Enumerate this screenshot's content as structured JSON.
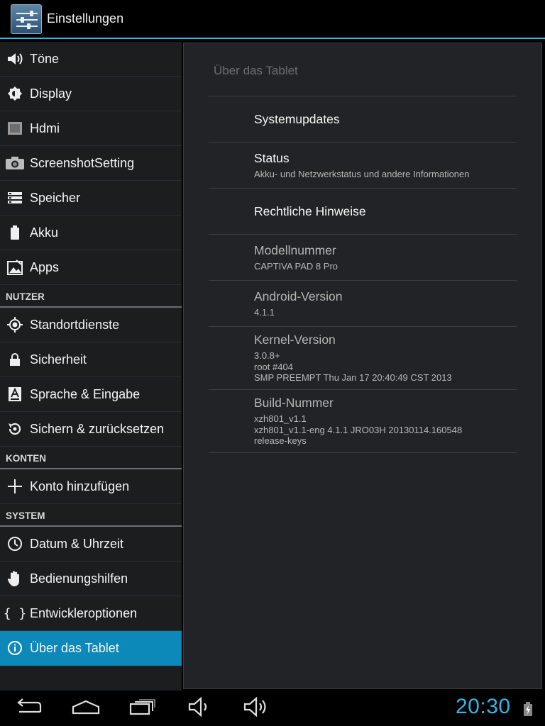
{
  "app": {
    "title": "Einstellungen"
  },
  "sidebar": {
    "group1": [
      {
        "label": "Töne",
        "icon": "speaker-icon"
      },
      {
        "label": "Display",
        "icon": "brightness-icon"
      },
      {
        "label": "Hdmi",
        "icon": "hdmi-icon"
      },
      {
        "label": "ScreenshotSetting",
        "icon": "camera-icon"
      },
      {
        "label": "Speicher",
        "icon": "storage-icon"
      },
      {
        "label": "Akku",
        "icon": "battery-icon"
      },
      {
        "label": "Apps",
        "icon": "apps-icon"
      }
    ],
    "header_user": "NUTZER",
    "group2": [
      {
        "label": "Standortdienste",
        "icon": "location-icon"
      },
      {
        "label": "Sicherheit",
        "icon": "lock-icon"
      },
      {
        "label": "Sprache & Eingabe",
        "icon": "language-icon"
      },
      {
        "label": "Sichern & zurücksetzen",
        "icon": "backup-restore-icon"
      }
    ],
    "header_accounts": "KONTEN",
    "group3": [
      {
        "label": "Konto hinzufügen",
        "icon": "plus-icon"
      }
    ],
    "header_system": "SYSTEM",
    "group4": [
      {
        "label": "Datum & Uhrzeit",
        "icon": "clock-icon"
      },
      {
        "label": "Bedienungshilfen",
        "icon": "hand-icon"
      },
      {
        "label": "Entwickleroptionen",
        "icon": "braces-icon"
      },
      {
        "label": "Über das Tablet",
        "icon": "info-icon",
        "selected": true
      }
    ]
  },
  "content": {
    "title": "Über das Tablet",
    "items": [
      {
        "title": "Systemupdates",
        "lines": []
      },
      {
        "title": "Status",
        "lines": [
          "Akku- und Netzwerkstatus und andere Informationen"
        ]
      },
      {
        "title": "Rechtliche Hinweise",
        "lines": []
      },
      {
        "title": "Modellnummer",
        "lines": [
          "CAPTIVA PAD 8 Pro"
        ]
      },
      {
        "title": "Android-Version",
        "lines": [
          "4.1.1"
        ]
      },
      {
        "title": "Kernel-Version",
        "lines": [
          "3.0.8+",
          "root #404",
          "SMP PREEMPT Thu Jan 17 20:40:49 CST 2013"
        ]
      },
      {
        "title": "Build-Nummer",
        "lines": [
          "xzh801_v1.1",
          "xzh801_v1.1-eng 4.1.1 JRO03H 20130114.160548",
          "release-keys"
        ]
      }
    ]
  },
  "statusbar": {
    "time": "20:30"
  },
  "colors": {
    "accent": "#33b5e5",
    "selected": "#0c89b8"
  }
}
